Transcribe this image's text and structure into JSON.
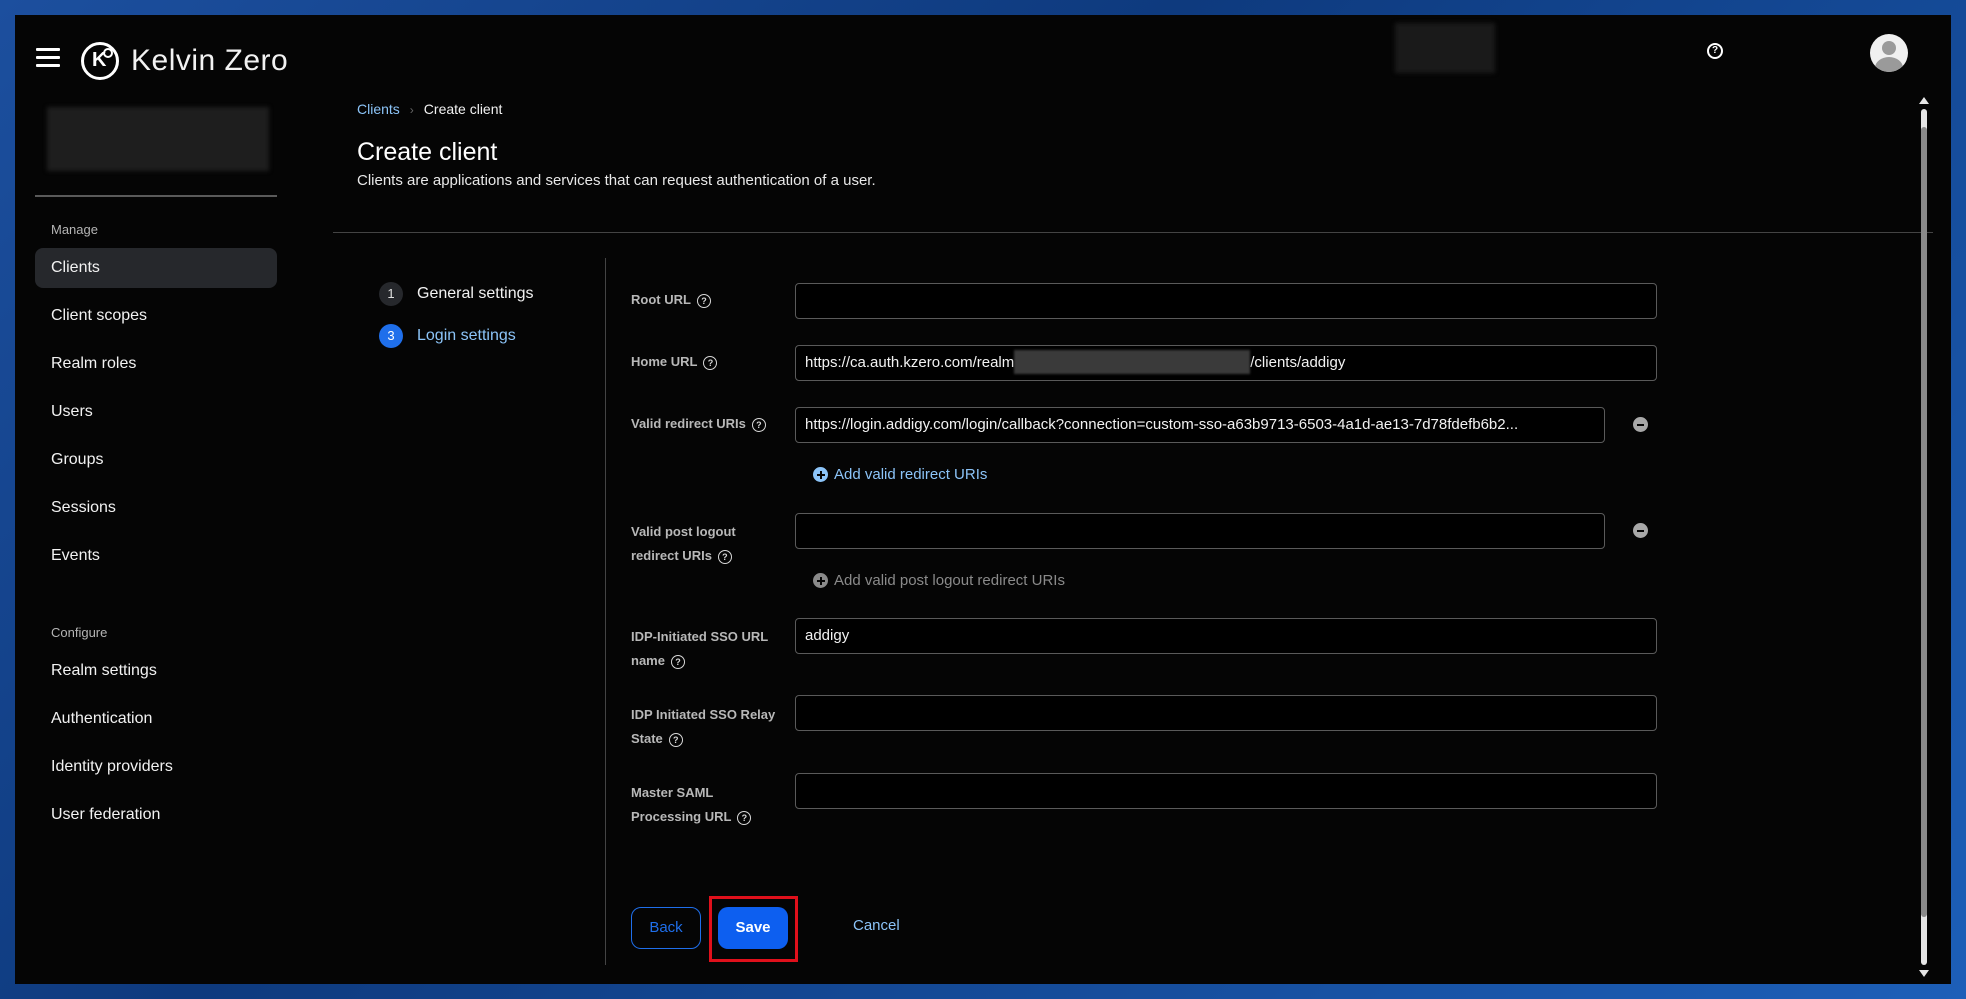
{
  "header": {
    "brand": "Kelvin Zero",
    "icons": {
      "menu": "hamburger-menu-icon",
      "help": "help-icon",
      "user": "user-avatar-icon"
    }
  },
  "sidebar": {
    "manage_title": "Manage",
    "manage_items": [
      {
        "label": "Clients",
        "active": true
      },
      {
        "label": "Client scopes"
      },
      {
        "label": "Realm roles"
      },
      {
        "label": "Users"
      },
      {
        "label": "Groups"
      },
      {
        "label": "Sessions"
      },
      {
        "label": "Events"
      }
    ],
    "configure_title": "Configure",
    "configure_items": [
      {
        "label": "Realm settings"
      },
      {
        "label": "Authentication"
      },
      {
        "label": "Identity providers"
      },
      {
        "label": "User federation"
      }
    ]
  },
  "breadcrumb": {
    "parent": "Clients",
    "current": "Create client"
  },
  "page": {
    "title": "Create client",
    "description": "Clients are applications and services that can request authentication of a user."
  },
  "steps": [
    {
      "number": "1",
      "label": "General settings"
    },
    {
      "number": "3",
      "label": "Login settings",
      "active": true
    }
  ],
  "form": {
    "root_url": {
      "label": "Root URL",
      "value": ""
    },
    "home_url": {
      "label": "Home URL",
      "value_prefix": "https://ca.auth.kzero.com/realm",
      "value_suffix": "/clients/addigy"
    },
    "valid_redirect_uris": {
      "label": "Valid redirect URIs",
      "value": "https://login.addigy.com/login/callback?connection=custom-sso-a63b9713-6503-4a1d-ae13-7d78fdefb6b2...",
      "add_label": "Add valid redirect URIs"
    },
    "valid_post_logout": {
      "label_line1": "Valid post logout",
      "label_line2": "redirect URIs",
      "value": "",
      "add_label": "Add valid post logout redirect URIs"
    },
    "idp_sso_url_name": {
      "label_line1": "IDP-Initiated SSO URL",
      "label_line2": "name",
      "value": "addigy"
    },
    "idp_relay_state": {
      "label_line1": "IDP Initiated SSO Relay",
      "label_line2": "State",
      "value": ""
    },
    "master_saml": {
      "label_line1": "Master SAML",
      "label_line2": "Processing URL",
      "value": ""
    }
  },
  "actions": {
    "back": "Back",
    "save": "Save",
    "cancel": "Cancel"
  },
  "colors": {
    "accent": "#1f6feb",
    "link": "#8cc4f8",
    "highlight": "#e0101b"
  }
}
